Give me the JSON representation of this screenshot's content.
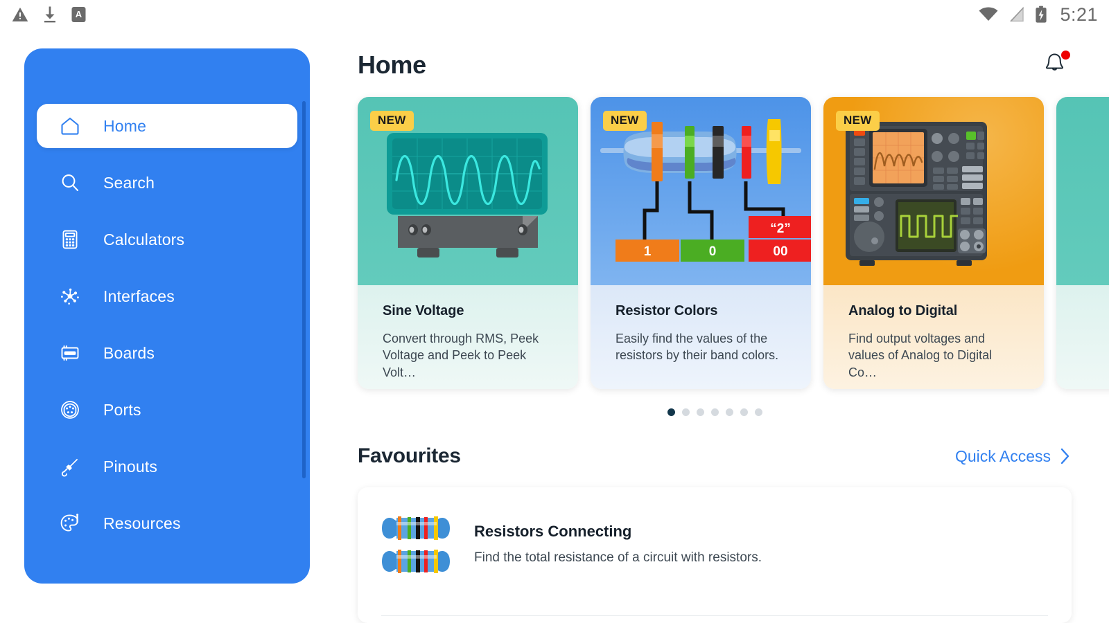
{
  "status_bar": {
    "left_icons": [
      "warning-triangle-icon",
      "download-icon",
      "app-a-icon"
    ],
    "right_icons": [
      "wifi-icon",
      "signal-off-icon",
      "battery-charging-icon"
    ],
    "time": "5:21"
  },
  "sidebar": {
    "accent_color": "#3180F0",
    "items": [
      {
        "label": "Home",
        "icon": "home-icon",
        "active": true
      },
      {
        "label": "Search",
        "icon": "search-icon",
        "active": false
      },
      {
        "label": "Calculators",
        "icon": "calculator-icon",
        "active": false
      },
      {
        "label": "Interfaces",
        "icon": "network-icon",
        "active": false
      },
      {
        "label": "Boards",
        "icon": "board-icon",
        "active": false
      },
      {
        "label": "Ports",
        "icon": "port-icon",
        "active": false
      },
      {
        "label": "Pinouts",
        "icon": "jack-icon",
        "active": false
      },
      {
        "label": "Resources",
        "icon": "palette-icon",
        "active": false
      }
    ]
  },
  "header": {
    "title": "Home",
    "notification_icon": "bell-icon",
    "notification_badge": true,
    "badge_color": "#ee0000"
  },
  "carousel": {
    "badge_label": "NEW",
    "badge_color": "#FBCE48",
    "cards": [
      {
        "title": "Sine Voltage",
        "description": "Convert through RMS, Peek Voltage and Peek to Peek Volt…",
        "badge": "NEW",
        "theme": "teal",
        "art": "oscilloscope-sine-wave"
      },
      {
        "title": "Resistor Colors",
        "description": "Easily find the values of the resistors by their band colors.",
        "badge": "NEW",
        "theme": "blue",
        "art": "resistor-color-bands",
        "art_labels": [
          "1",
          "0",
          "“2”",
          "00"
        ]
      },
      {
        "title": "Analog to Digital",
        "description": "Find output voltages and values of Analog to Digital Co…",
        "badge": "NEW",
        "theme": "orange",
        "art": "adc-instrument"
      },
      {
        "title": "",
        "description": "",
        "badge": "",
        "theme": "teal2",
        "art": "partial-card"
      }
    ],
    "dots": {
      "count": 7,
      "active_index": 0
    }
  },
  "favourites": {
    "section_title": "Favourites",
    "quick_access_label": "Quick Access",
    "chevron_icon": "chevron-right-icon",
    "items": [
      {
        "name": "Resistors Connecting",
        "description": "Find the total resistance of a circuit with resistors.",
        "icon": "resistors-pair-icon"
      }
    ]
  }
}
